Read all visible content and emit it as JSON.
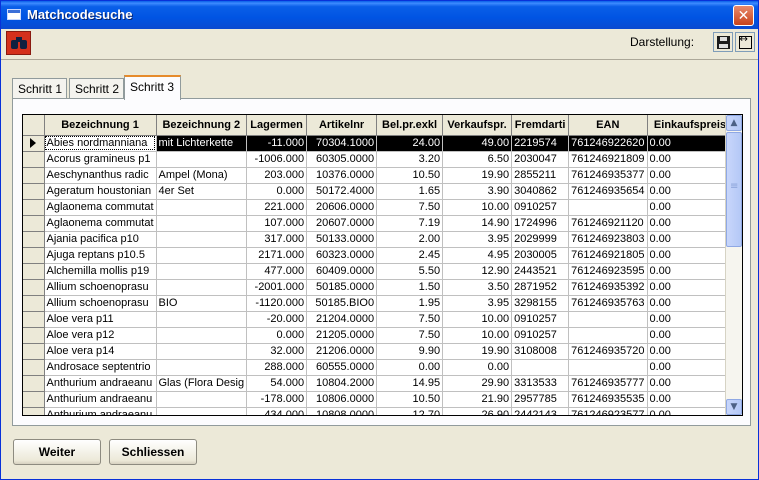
{
  "window": {
    "title": "Matchcodesuche",
    "close_label": "✕"
  },
  "toolbar": {
    "search_icon": "binoculars-icon",
    "darstellung_label": "Darstellung:",
    "save_icon": "floppy-disk-icon",
    "fit_icon": "fit-columns-icon"
  },
  "tabs": [
    {
      "label": "Schritt 1",
      "active": false
    },
    {
      "label": "Schritt 2",
      "active": false
    },
    {
      "label": "Schritt 3",
      "active": true
    }
  ],
  "grid": {
    "columns": [
      "Bezeichnung 1",
      "Bezeichnung 2",
      "Lagermen",
      "Artikelnr",
      "Bel.pr.exkl",
      "Verkaufspr.",
      "Fremdarti",
      "EAN",
      "Einkaufspreis"
    ],
    "rows": [
      [
        "Abies nordmanniana",
        "mit Lichterkette",
        "-11.000",
        "70304.1000",
        "24.00",
        "49.00",
        "2219574",
        "761246922620",
        "0.00"
      ],
      [
        "Acorus gramineus p1",
        "",
        "-1006.000",
        "60305.0000",
        "3.20",
        "6.50",
        "2030047",
        "761246921809",
        "0.00"
      ],
      [
        "Aeschynanthus radic",
        "Ampel (Mona)",
        "203.000",
        "10376.0000",
        "10.50",
        "19.90",
        "2855211",
        "761246935377",
        "0.00"
      ],
      [
        "Ageratum houstonian",
        "4er Set",
        "0.000",
        "50172.4000",
        "1.65",
        "3.90",
        "3040862",
        "761246935654",
        "0.00"
      ],
      [
        "Aglaonema commutat",
        "",
        "221.000",
        "20606.0000",
        "7.50",
        "10.00",
        "0910257",
        "",
        "0.00"
      ],
      [
        "Aglaonema commutat",
        "",
        "107.000",
        "20607.0000",
        "7.19",
        "14.90",
        "1724996",
        "761246921120",
        "0.00"
      ],
      [
        "Ajania pacifica p10",
        "",
        "317.000",
        "50133.0000",
        "2.00",
        "3.95",
        "2029999",
        "761246923803",
        "0.00"
      ],
      [
        "Ajuga reptans p10.5",
        "",
        "2171.000",
        "60323.0000",
        "2.45",
        "4.95",
        "2030005",
        "761246921805",
        "0.00"
      ],
      [
        "Alchemilla mollis p19",
        "",
        "477.000",
        "60409.0000",
        "5.50",
        "12.90",
        "2443521",
        "761246923595",
        "0.00"
      ],
      [
        "Allium schoenoprasu",
        "",
        "-2001.000",
        "50185.0000",
        "1.50",
        "3.50",
        "2871952",
        "761246935392",
        "0.00"
      ],
      [
        "Allium schoenoprasu",
        "BIO",
        "-1120.000",
        "50185.BIO0",
        "1.95",
        "3.95",
        "3298155",
        "761246935763",
        "0.00"
      ],
      [
        "Aloe vera p11",
        "",
        "-20.000",
        "21204.0000",
        "7.50",
        "10.00",
        "0910257",
        "",
        "0.00"
      ],
      [
        "Aloe vera p12",
        "",
        "0.000",
        "21205.0000",
        "7.50",
        "10.00",
        "0910257",
        "",
        "0.00"
      ],
      [
        "Aloe vera p14",
        "",
        "32.000",
        "21206.0000",
        "9.90",
        "19.90",
        "3108008",
        "761246935720",
        "0.00"
      ],
      [
        "Androsace septentrio",
        "",
        "288.000",
        "60555.0000",
        "0.00",
        "0.00",
        "",
        "",
        "0.00"
      ],
      [
        "Anthurium andraeanu",
        "Glas (Flora Desig",
        "54.000",
        "10804.2000",
        "14.95",
        "29.90",
        "3313533",
        "761246935777",
        "0.00"
      ],
      [
        "Anthurium andraeanu",
        "",
        "-178.000",
        "10806.0000",
        "10.50",
        "21.90",
        "2957785",
        "761246935535",
        "0.00"
      ],
      [
        "Anthurium andraeanu",
        "",
        "434.000",
        "10808.0000",
        "12.70",
        "26.90",
        "2442143",
        "761246923577",
        "0.00"
      ]
    ]
  },
  "buttons": {
    "weiter": "Weiter",
    "schliessen": "Schliessen"
  }
}
